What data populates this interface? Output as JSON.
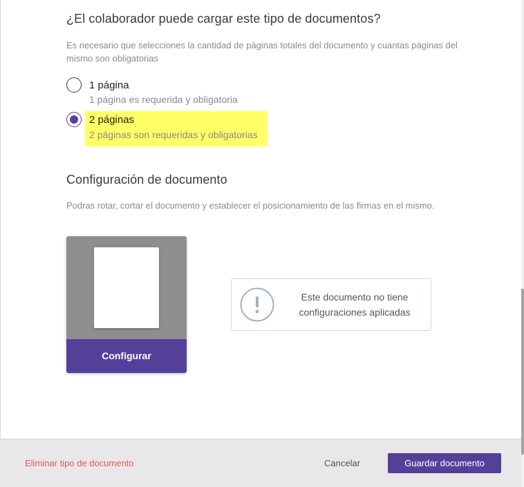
{
  "upload_section": {
    "title": "¿El colaborador puede cargar este tipo de documentos?",
    "description": "Es necesario que selecciones la cantidad de páginas totales del documento y cuantas páginas del mismo son obligatorias",
    "options": [
      {
        "label": "1 página",
        "sublabel": "1 página es requerida y obligatoria",
        "selected": false
      },
      {
        "label": "2 páginas",
        "sublabel": "2 páginas son requeridas y obligatorias",
        "selected": true
      }
    ]
  },
  "config_section": {
    "title": "Configuración de documento",
    "description": "Podras rotar, cortar el documento y establecer el posicionamiento de las firmas en el mismo.",
    "configure_button": "Configurar",
    "info_icon": "exclamation-circle-icon",
    "info_message": "Este documento no tiene configuraciones aplicadas"
  },
  "footer": {
    "delete_label": "Eliminar tipo de documento",
    "cancel_label": "Cancelar",
    "save_label": "Guardar documento"
  },
  "colors": {
    "accent": "#554099",
    "danger": "#e05a5a",
    "highlight": "#ffff66"
  }
}
